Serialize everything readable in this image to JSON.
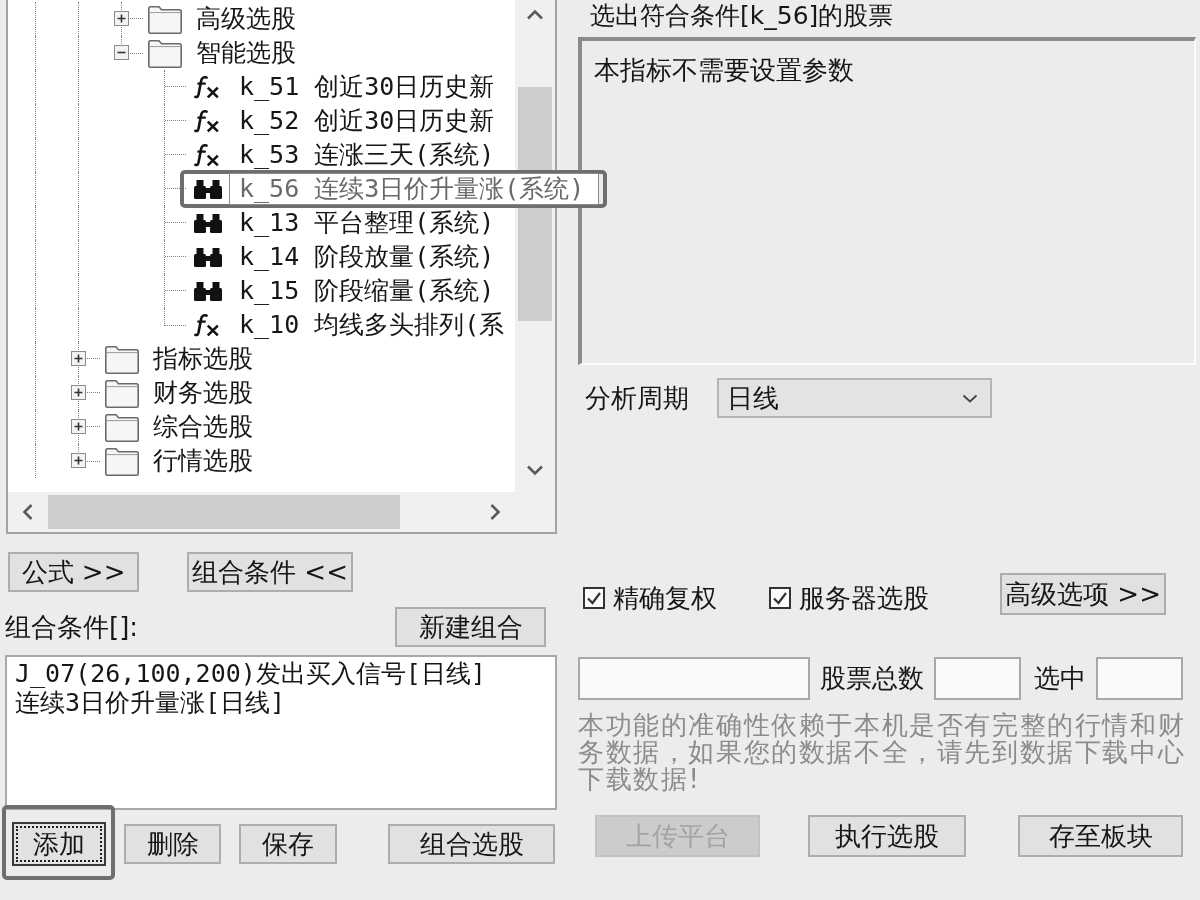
{
  "tree": {
    "items": [
      {
        "children": [
          {
            "kind": "folder",
            "label": "高级选股",
            "expanded": false,
            "selected": false,
            "highlighted": false
          },
          {
            "kind": "folder",
            "label": "智能选股",
            "expanded": true,
            "selected": false,
            "highlighted": false,
            "children": [
              {
                "kind": "formula",
                "label": "k_51 创近30日历史新",
                "selected": false,
                "highlighted": false
              },
              {
                "kind": "formula",
                "label": "k_52 创近30日历史新",
                "selected": false,
                "highlighted": false
              },
              {
                "kind": "formula",
                "label": "k_53 连涨三天(系统)",
                "selected": false,
                "highlighted": false
              },
              {
                "kind": "binoculars",
                "label": "k_56 连续3日价升量涨(系统)",
                "selected": true,
                "highlighted": true
              },
              {
                "kind": "binoculars",
                "label": "k_13 平台整理(系统)",
                "selected": false,
                "highlighted": false
              },
              {
                "kind": "binoculars",
                "label": "k_14 阶段放量(系统)",
                "selected": false,
                "highlighted": false
              },
              {
                "kind": "binoculars",
                "label": "k_15 阶段缩量(系统)",
                "selected": false,
                "highlighted": false
              },
              {
                "kind": "formula",
                "label": "k_10 均线多头排列(系",
                "selected": false,
                "highlighted": false
              }
            ]
          }
        ]
      },
      {
        "kind": "folder",
        "label": "指标选股",
        "expanded": false,
        "selected": false,
        "highlighted": false
      },
      {
        "kind": "folder",
        "label": "财务选股",
        "expanded": false,
        "selected": false,
        "highlighted": false
      },
      {
        "kind": "folder",
        "label": "综合选股",
        "expanded": false,
        "selected": false,
        "highlighted": false
      },
      {
        "kind": "folder",
        "label": "行情选股",
        "expanded": false,
        "selected": false,
        "highlighted": false
      }
    ]
  },
  "panel_buttons": [
    "公式 >>",
    "组合条件 <<"
  ],
  "combination": {
    "label": "组合条件[]:",
    "new_button": "新建组合",
    "conditions": [
      "J_07(26,100,200)发出买入信号[日线]",
      "连续3日价升量涨[日线]"
    ],
    "buttons": [
      {
        "label": "添加",
        "focused": true,
        "highlighted": true
      },
      {
        "label": "删除",
        "focused": false,
        "highlighted": false
      },
      {
        "label": "保存",
        "focused": false,
        "highlighted": false
      },
      {
        "label": "组合选股",
        "focused": false,
        "highlighted": false
      }
    ]
  },
  "criteria": {
    "title": "选出符合条件[k_56]的股票",
    "message": "本指标不需要设置参数",
    "period": {
      "label": "分析周期",
      "value": "日线"
    }
  },
  "options": {
    "checkboxes": [
      {
        "label": "精确复权",
        "checked": true
      },
      {
        "label": "服务器选股",
        "checked": true
      }
    ],
    "advanced_button": "高级选项 >>"
  },
  "counts": {
    "total_label": "股票总数",
    "selected_label": "选中"
  },
  "note": "本功能的准确性依赖于本机是否有完整的行情和财务数据，如果您的数据不全，请先到数据下载中心下载数据!",
  "actions": [
    {
      "label": "上传平台",
      "disabled": true
    },
    {
      "label": "执行选股",
      "disabled": false
    },
    {
      "label": "存至板块",
      "disabled": false
    }
  ]
}
